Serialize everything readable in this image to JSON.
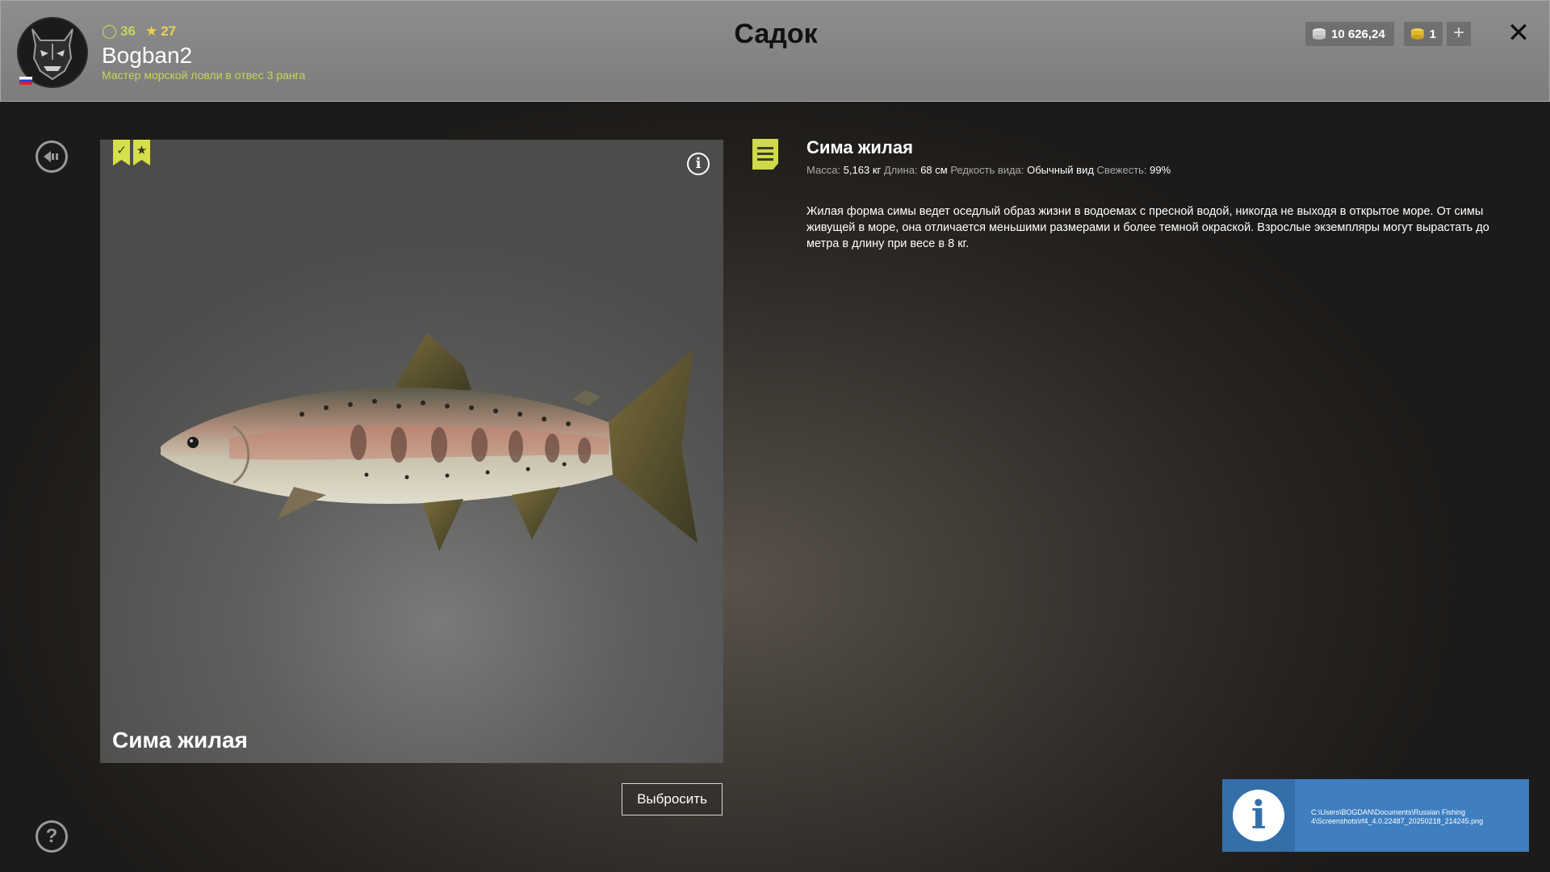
{
  "header": {
    "title": "Садок",
    "player": {
      "name": "Bogban2",
      "level": "36",
      "stars": "27",
      "rank": "Мастер морской ловли в отвес 3 ранга"
    },
    "currency": {
      "silver": "10 626,24",
      "gold": "1"
    },
    "plus_label": "+",
    "close_label": "✕"
  },
  "fish": {
    "name": "Сима жилая",
    "attributes": {
      "mass_label": "Масса:",
      "mass_value": "5,163 кг",
      "length_label": "Длина:",
      "length_value": "68 см",
      "rarity_label": "Редкость вида:",
      "rarity_value": "Обычный вид",
      "freshness_label": "Свежесть:",
      "freshness_value": "99%"
    },
    "description": "Жилая форма симы ведет оседлый образ жизни в водоемах с пресной водой, никогда не выходя в открытое море. От симы живущей в море, она отличается меньшими размерами и более темной окраской. Взрослые экземпляры могут вырастать до метра в длину при весе в 8 кг."
  },
  "actions": {
    "discard_label": "Выбросить",
    "help_label": "?",
    "info_label": "i"
  },
  "notification": {
    "icon_label": "i",
    "text": "C:\\Users\\BOGDAN\\Documents\\Russian Fishing 4\\Screenshots\\rf4_4.0.22487_20250218_214245.png"
  },
  "colors": {
    "accent": "#d6e04a",
    "notification": "#3f7fbf"
  }
}
